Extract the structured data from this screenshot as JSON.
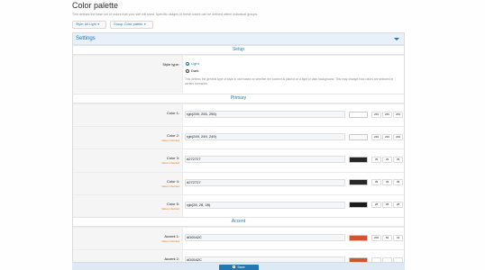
{
  "page": {
    "title": "Color palette",
    "description": "This defines the base set of colors that your site will used. Specific usages of these colors can be defined within individual groups."
  },
  "toolbar": {
    "style_button": "Style: Alt Light",
    "group_button": "Group: Color palette"
  },
  "block": {
    "title": "Settings"
  },
  "sections": {
    "setup": "Setup",
    "primary": "Primary",
    "accent": "Accent"
  },
  "style_type": {
    "label": "Style type:",
    "options": [
      "Light",
      "Dark"
    ],
    "selected": "Light",
    "explain": "This defines the general type of style in use based on whether the content is placed on a light or dark background. This may change how colors are selected in certain scenarios."
  },
  "colors": [
    {
      "label": "Color 1:",
      "sub": "",
      "value": "rgb(255, 255, 255)",
      "swatch": "#ffffff",
      "channels": [
        "255",
        "255",
        "255"
      ]
    },
    {
      "label": "Color 2:",
      "sub": "Value inherited",
      "value": "rgb(249, 249, 249)",
      "swatch": "#f9f9f9",
      "channels": [
        "249",
        "249",
        "249"
      ]
    },
    {
      "label": "Color 3:",
      "sub": "Value inherited",
      "value": "#272727",
      "swatch": "#272727",
      "channels": [
        "39",
        "39",
        "39"
      ]
    },
    {
      "label": "Color 4:",
      "sub": "Value inherited",
      "value": "#272727",
      "swatch": "#272727",
      "channels": [
        "39",
        "39",
        "39"
      ]
    },
    {
      "label": "Color 5:",
      "sub": "Value inherited",
      "value": "rgb(28, 28, 28)",
      "swatch": "#1c1c1c",
      "channels": [
        "28",
        "28",
        "28"
      ]
    }
  ],
  "accents": [
    {
      "label": "Accent 1:",
      "sub": "Value inherited",
      "value": "#D0542C",
      "swatch": "#d0542c",
      "channels": [
        "208",
        "84",
        "44"
      ]
    },
    {
      "label": "Accent 2:",
      "sub": "",
      "value": "#D0542C",
      "swatch": "#d0542c",
      "channels": [
        "",
        "",
        ""
      ]
    }
  ],
  "footer": {
    "save_label": "Save"
  },
  "colors_theme": {
    "accent": "#2577b1",
    "inherited": "#e87b12"
  }
}
